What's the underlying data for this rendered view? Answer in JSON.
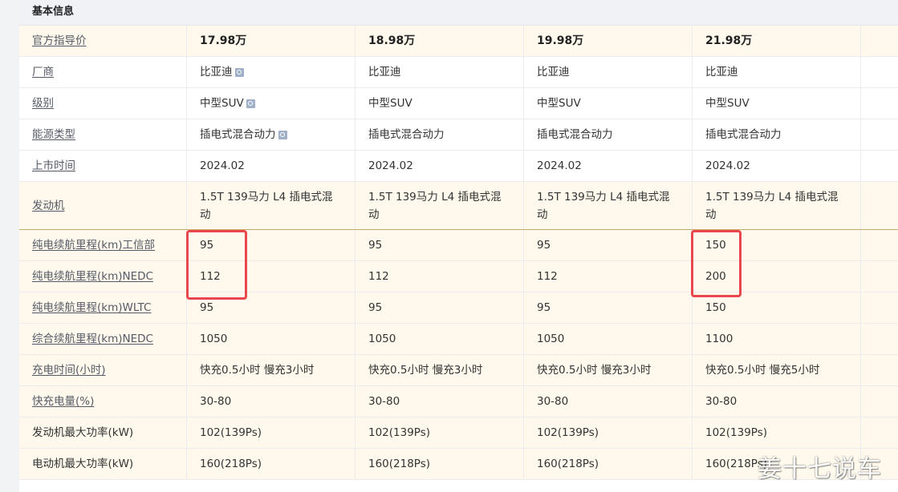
{
  "section": {
    "title": "基本信息"
  },
  "rows": [
    {
      "label": "官方指导价",
      "cells": [
        "17.98万",
        "18.98万",
        "19.98万",
        "21.98万",
        ""
      ]
    },
    {
      "label": "厂商",
      "cells": [
        "比亚迪",
        "比亚迪",
        "比亚迪",
        "比亚迪",
        ""
      ]
    },
    {
      "label": "级别",
      "cells": [
        "中型SUV",
        "中型SUV",
        "中型SUV",
        "中型SUV",
        ""
      ]
    },
    {
      "label": "能源类型",
      "cells": [
        "插电式混合动力",
        "插电式混合动力",
        "插电式混合动力",
        "插电式混合动力",
        ""
      ]
    },
    {
      "label": "上市时间",
      "cells": [
        "2024.02",
        "2024.02",
        "2024.02",
        "2024.02",
        ""
      ]
    },
    {
      "label": "发动机",
      "cells": [
        "1.5T 139马力 L4 插电式混动",
        "1.5T 139马力 L4 插电式混动",
        "1.5T 139马力 L4 插电式混动",
        "1.5T 139马力 L4 插电式混动",
        ""
      ]
    },
    {
      "label": "纯电续航里程(km)工信部",
      "cells": [
        "95",
        "95",
        "95",
        "150",
        ""
      ]
    },
    {
      "label": "纯电续航里程(km)NEDC",
      "cells": [
        "112",
        "112",
        "112",
        "200",
        ""
      ]
    },
    {
      "label": "纯电续航里程(km)WLTC",
      "cells": [
        "95",
        "95",
        "95",
        "150",
        ""
      ]
    },
    {
      "label": "综合续航里程(km)NEDC",
      "cells": [
        "1050",
        "1050",
        "1050",
        "1100",
        ""
      ]
    },
    {
      "label": "充电时间(小时)",
      "cells": [
        "快充0.5小时 慢充3小时",
        "快充0.5小时 慢充3小时",
        "快充0.5小时 慢充3小时",
        "快充0.5小时 慢充5小时",
        ""
      ]
    },
    {
      "label": "快充电量(%)",
      "cells": [
        "30-80",
        "30-80",
        "30-80",
        "30-80",
        ""
      ]
    },
    {
      "label": "发动机最大功率(kW)",
      "cells": [
        "102(139Ps)",
        "102(139Ps)",
        "102(139Ps)",
        "102(139Ps)",
        ""
      ]
    },
    {
      "label": "电动机最大功率(kW)",
      "cells": [
        "160(218Ps)",
        "160(218Ps)",
        "160(218Ps)",
        "160(218Ps)",
        ""
      ]
    }
  ],
  "watermark": "姜十七说车",
  "colors": {
    "highlight_row": "#fef9ec",
    "annotation_box": "#e8474d",
    "link_label": "#555a66"
  }
}
